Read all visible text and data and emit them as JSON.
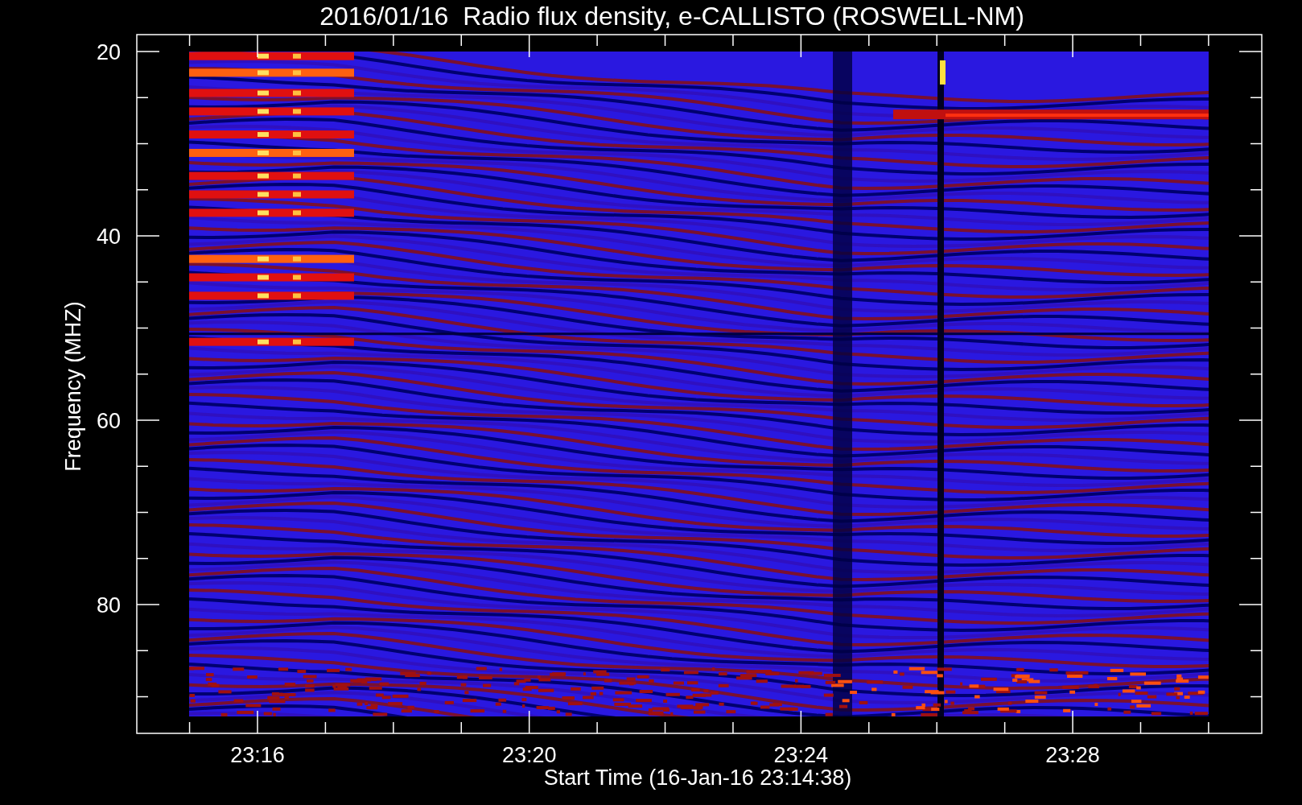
{
  "title": "2016/01/16  Radio flux density, e-CALLISTO (ROSWELL-NM)",
  "xlabel": "Start Time (16-Jan-16 23:14:38)",
  "ylabel": "Frequency (MHZ)",
  "yticks": [
    "20",
    "40",
    "60",
    "80"
  ],
  "xticks": [
    "23:16",
    "23:20",
    "23:24",
    "23:28"
  ]
}
